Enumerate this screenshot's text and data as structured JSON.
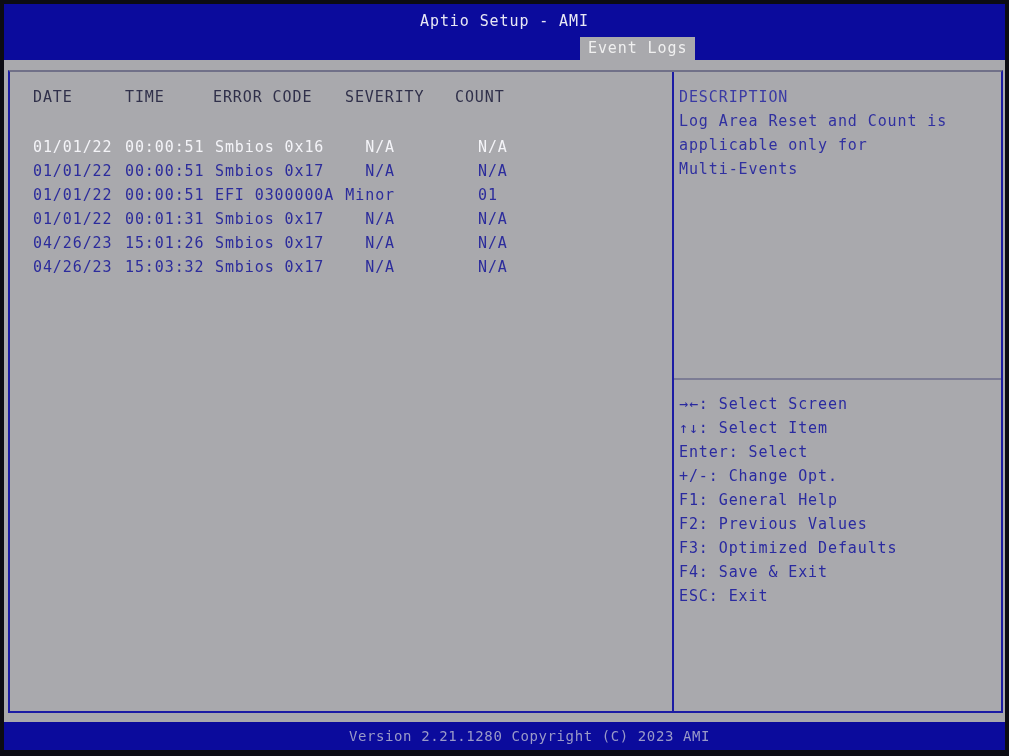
{
  "window": {
    "title": "Aptio Setup - AMI"
  },
  "tabs": [
    {
      "label": "Event Logs",
      "selected": true
    }
  ],
  "table": {
    "columns": [
      "DATE",
      "TIME",
      "ERROR CODE",
      "SEVERITY",
      "COUNT"
    ],
    "rows": [
      {
        "date": "01/01/22",
        "time": "00:00:51",
        "error_code": "Smbios 0x16",
        "severity": "N/A",
        "count": "N/A",
        "selected": true
      },
      {
        "date": "01/01/22",
        "time": "00:00:51",
        "error_code": "Smbios 0x17",
        "severity": "N/A",
        "count": "N/A",
        "selected": false
      },
      {
        "date": "01/01/22",
        "time": "00:00:51",
        "error_code": "EFI 0300000A",
        "severity": "Minor",
        "count": "01",
        "selected": false
      },
      {
        "date": "01/01/22",
        "time": "00:01:31",
        "error_code": "Smbios 0x17",
        "severity": "N/A",
        "count": "N/A",
        "selected": false
      },
      {
        "date": "04/26/23",
        "time": "15:01:26",
        "error_code": "Smbios 0x17",
        "severity": "N/A",
        "count": "N/A",
        "selected": false
      },
      {
        "date": "04/26/23",
        "time": "15:03:32",
        "error_code": "Smbios 0x17",
        "severity": "N/A",
        "count": "N/A",
        "selected": false
      }
    ]
  },
  "description": {
    "heading": "DESCRIPTION",
    "text": "Log Area Reset and Count is applicable only for Multi-Events"
  },
  "help": [
    "→←: Select Screen",
    "↑↓: Select Item",
    "Enter: Select",
    "+/-: Change Opt.",
    "F1: General Help",
    "F2: Previous Values",
    "F3: Optimized Defaults",
    "F4: Save & Exit",
    "ESC: Exit"
  ],
  "status_bar": {
    "text": "Version 2.21.1280 Copyright (C) 2023 AMI"
  }
}
